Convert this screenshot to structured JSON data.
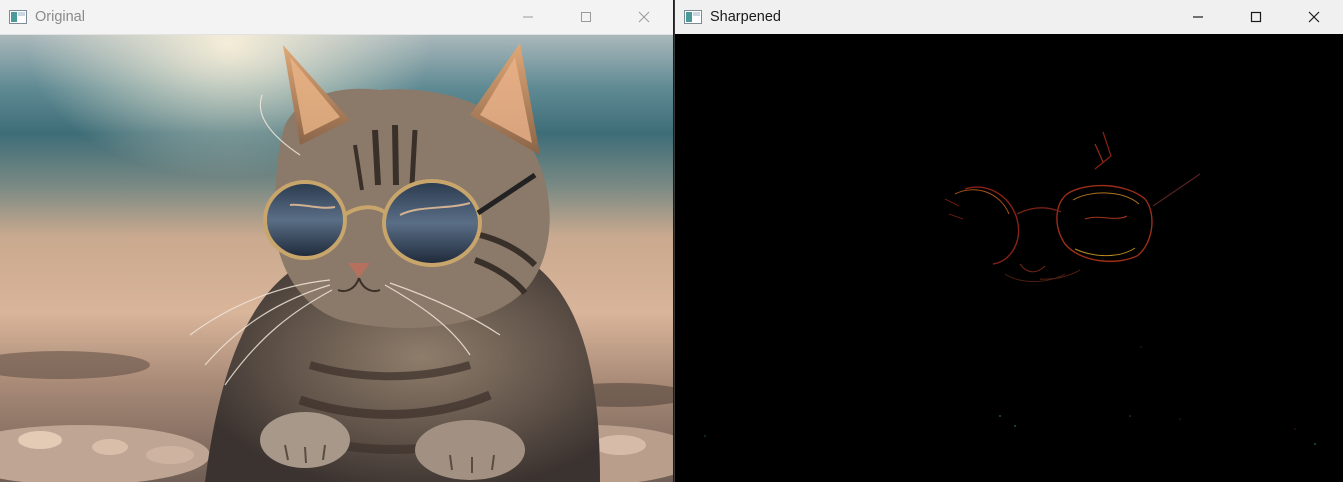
{
  "windows": {
    "original": {
      "title": "Original",
      "icons": [
        "app-window-icon",
        "minimize-icon",
        "maximize-icon",
        "close-icon"
      ]
    },
    "sharpened": {
      "title": "Sharpened",
      "icons": [
        "app-window-icon",
        "minimize-icon",
        "maximize-icon",
        "close-icon"
      ]
    }
  },
  "colors": {
    "titlebar": "#f0f0f0",
    "inactive_title_text": "#8a8a8a",
    "active_title_text": "#1a1a1a",
    "image_background_sharpened": "#000000"
  },
  "images": {
    "original": "photo of a tabby cat wearing round sunglasses lying on a beach",
    "sharpened": "mostly black image with faint red and yellow edge outlines of the cat and sunglasses"
  }
}
